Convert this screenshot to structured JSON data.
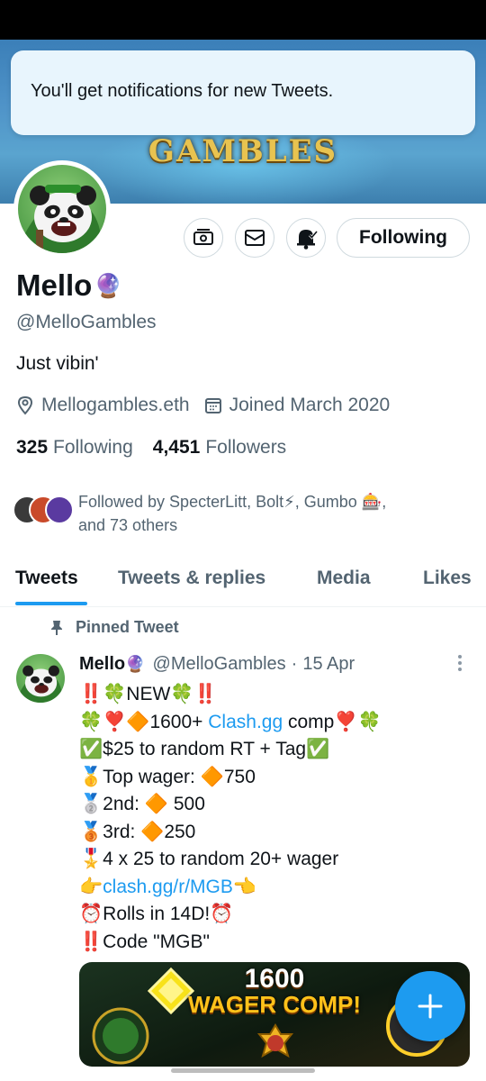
{
  "banner": {
    "title": "GAMBLES"
  },
  "toast": {
    "text": "You'll get notifications for new Tweets."
  },
  "profile": {
    "display_name": "Mello",
    "name_emoji": "🔮",
    "handle": "@MelloGambles",
    "bio": "Just vibin'",
    "website": "Mellogambles.eth",
    "joined": "Joined March 2020",
    "following_count": "325",
    "following_label": "Following",
    "followers_count": "4,451",
    "followers_label": "Followers",
    "follow_button": "Following",
    "followed_by_line1": "Followed by SpecterLitt, Bolt⚡, Gumbo 🎰,",
    "followed_by_line2": "and 73 others"
  },
  "tabs": [
    {
      "label": "Tweets",
      "active": true
    },
    {
      "label": "Tweets & replies",
      "active": false
    },
    {
      "label": "Media",
      "active": false
    },
    {
      "label": "Likes",
      "active": false
    }
  ],
  "pinned_tweet": {
    "pinned_label": "Pinned Tweet",
    "author_name": "Mello",
    "author_emoji": "🔮",
    "author_handle": "@MelloGambles",
    "dot": "·",
    "date": "15 Apr",
    "line1": "‼️🍀NEW🍀‼️",
    "line2_pre": "🍀❣️🔶1600+ ",
    "line2_link": "Clash.gg",
    "line2_post": " comp❣️🍀",
    "line3": "✅$25 to random RT + Tag✅",
    "line4": "🥇Top wager: 🔶750",
    "line5": "🥈2nd: 🔶 500",
    "line6": "🥉3rd: 🔶250",
    "line7": "🎖️4 x 25 to random 20+ wager",
    "line8_pre": "👉",
    "line8_link": "clash.gg/r/MGB",
    "line8_post": "👈",
    "line9": "⏰Rolls in 14D!⏰",
    "line10": "‼️Code \"MGB\"",
    "media_title1": "1600",
    "media_title2": "WAGER COMP!"
  },
  "colors": {
    "accent": "#1d9bf0",
    "secondary_text": "#536471",
    "primary_text": "#0f1419",
    "toast_bg": "#e8f5fd"
  },
  "icons": [
    "location-icon",
    "calendar-icon",
    "tip-icon",
    "mail-icon",
    "bell-icon",
    "pin-icon",
    "more-icon",
    "compose-plus-icon"
  ]
}
